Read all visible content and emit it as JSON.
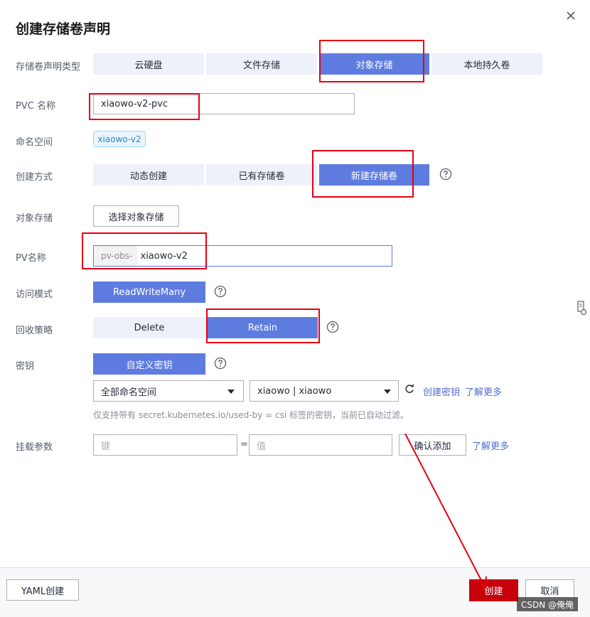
{
  "dialog": {
    "title": "创建存储卷声明"
  },
  "pvc_type": {
    "label": "存储卷声明类型",
    "options": [
      "云硬盘",
      "文件存储",
      "对象存储",
      "本地持久卷"
    ],
    "selected": "对象存储"
  },
  "pvc_name": {
    "label": "PVC 名称",
    "value": "xiaowo-v2-pvc"
  },
  "namespace": {
    "label": "命名空间",
    "value": "xiaowo-v2"
  },
  "create_mode": {
    "label": "创建方式",
    "options": [
      "动态创建",
      "已有存储卷",
      "新建存储卷"
    ],
    "selected": "新建存储卷"
  },
  "object_storage": {
    "label": "对象存储",
    "button": "选择对象存储"
  },
  "pv_name": {
    "label": "PV名称",
    "prefix": "pv-obs-",
    "value": "xiaowo-v2"
  },
  "access_mode": {
    "label": "访问模式",
    "value": "ReadWriteMany"
  },
  "reclaim": {
    "label": "回收策略",
    "options": [
      "Delete",
      "Retain"
    ],
    "selected": "Retain"
  },
  "secret": {
    "label": "密钥",
    "button": "自定义密钥",
    "namespace_select": "全部命名空间",
    "secret_select": "xiaowo | xiaowo",
    "create_link": "创建密钥",
    "learn_more": "了解更多",
    "hint": "仅支持带有 secret.kubernetes.io/used-by = csi 标签的密钥，当前已自动过滤。"
  },
  "mount_params": {
    "label": "挂载参数",
    "key_placeholder": "键",
    "equals": "=",
    "value_placeholder": "值",
    "confirm": "确认添加",
    "learn_more": "了解更多"
  },
  "footer": {
    "yaml": "YAML创建",
    "create": "创建",
    "cancel": "取消"
  },
  "watermark": "CSDN @俺俺",
  "colors": {
    "accent": "#5e7ce0",
    "danger": "#c7000b",
    "annotation": "#e60012"
  }
}
